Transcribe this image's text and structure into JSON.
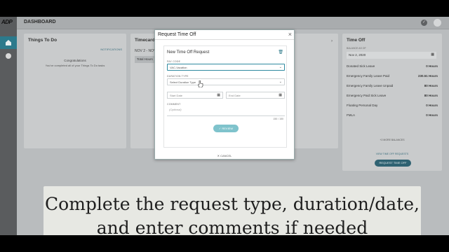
{
  "app": {
    "logo": "ADP",
    "page_title": "DASHBOARD"
  },
  "todo": {
    "title": "Things To Do",
    "notifications": "NOTIFICATIONS",
    "congrats": "Congratulations",
    "message": "You've completed all of your Things To Do tasks"
  },
  "timecard": {
    "title": "Timecard",
    "range": "NOV 2 - NOV",
    "total_hours": "Total Hours"
  },
  "timeoff": {
    "title": "Time Off",
    "balance_label": "BALANCE AS OF",
    "balance_date": "Nov 2, 2020",
    "rows": [
      {
        "name": "Donated Sick Leave",
        "value": "0 Hours"
      },
      {
        "name": "Emergency Family Leave Paid",
        "value": "230.51 Hours"
      },
      {
        "name": "Emergency Family Leave Unpaid",
        "value": "80 Hours"
      },
      {
        "name": "Emergency Paid Sick Leave",
        "value": "80 Hours"
      },
      {
        "name": "Floating Personal Day",
        "value": "0 Hours"
      },
      {
        "name": "FMLA",
        "value": "0 Hours"
      }
    ],
    "more": "+2 MORE BALANCES",
    "view": "VIEW TIME OFF REQUESTS",
    "request_button": "REQUEST TIME OFF"
  },
  "modal": {
    "title": "Request Time Off",
    "close": "×",
    "form_title": "New Time Off Request",
    "pay_code_label": "PAY CODE",
    "pay_code_value": "VAC-Vacation",
    "duration_label": "DURATION TYPE",
    "duration_placeholder": "Select Duration Type",
    "start_date_placeholder": "Start Date",
    "end_date_placeholder": "End Date",
    "comment_label": "COMMENT",
    "comment_placeholder": "(Optional)",
    "char_count": "150 / 150",
    "review_button": "REVIEW",
    "cancel_button": "CANCEL"
  },
  "caption": {
    "line1": "Complete the request type, duration/date,",
    "line2": "and enter comments if needed"
  },
  "colors": {
    "accent": "#2f6272",
    "review": "#7fc3cc",
    "overlay": "#b9bcbe"
  }
}
